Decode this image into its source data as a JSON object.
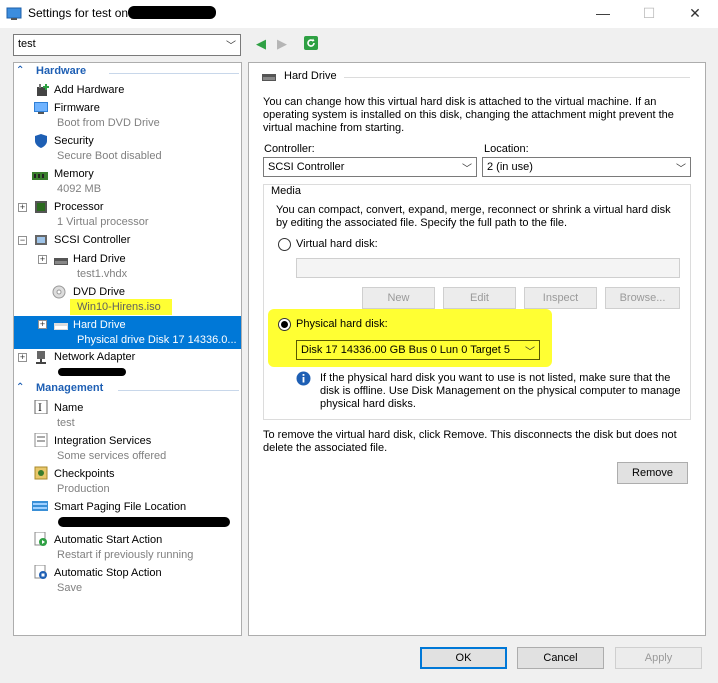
{
  "window": {
    "title": "Settings for test on",
    "minimize_glyph": "—",
    "maximize_glyph": "☐",
    "close_glyph": "✕"
  },
  "vm_selector": {
    "value": "test"
  },
  "tree": {
    "hardware_header": "Hardware",
    "management_header": "Management",
    "items": {
      "add_hardware": {
        "label": "Add Hardware"
      },
      "firmware": {
        "label": "Firmware",
        "sub": "Boot from DVD Drive"
      },
      "security": {
        "label": "Security",
        "sub": "Secure Boot disabled"
      },
      "memory": {
        "label": "Memory",
        "sub": "4092 MB"
      },
      "processor": {
        "label": "Processor",
        "sub": "1 Virtual processor"
      },
      "scsi": {
        "label": "SCSI Controller"
      },
      "hard_drive_1": {
        "label": "Hard Drive",
        "sub": "test1.vhdx"
      },
      "dvd": {
        "label": "DVD Drive",
        "sub": "Win10-Hirens.iso"
      },
      "hard_drive_2": {
        "label": "Hard Drive",
        "sub": "Physical drive Disk 17 14336.0..."
      },
      "network": {
        "label": "Network Adapter"
      },
      "name": {
        "label": "Name",
        "sub": "test"
      },
      "integration": {
        "label": "Integration Services",
        "sub": "Some services offered"
      },
      "checkpoints": {
        "label": "Checkpoints",
        "sub": "Production"
      },
      "paging": {
        "label": "Smart Paging File Location"
      },
      "auto_start": {
        "label": "Automatic Start Action",
        "sub": "Restart if previously running"
      },
      "auto_stop": {
        "label": "Automatic Stop Action",
        "sub": "Save"
      }
    }
  },
  "pane": {
    "heading": "Hard Drive",
    "intro_lines": [
      "You can change how this virtual hard disk is attached to the virtual machine. If an",
      "operating system is installed on this disk, changing the attachment might prevent the",
      "virtual machine from starting."
    ],
    "controller_label": "Controller:",
    "controller_value": "SCSI Controller",
    "location_label": "Location:",
    "location_value": "2 (in use)",
    "media_label": "Media",
    "media_lines": [
      "You can compact, convert, expand, merge, reconnect or shrink a virtual hard disk",
      "by editing the associated file. Specify the full path to the file."
    ],
    "virtual_hd_label": "Virtual hard disk:",
    "buttons": {
      "new": "New",
      "edit": "Edit",
      "inspect": "Inspect",
      "browse": "Browse..."
    },
    "physical_hd_label": "Physical hard disk:",
    "physical_hd_value": "Disk 17 14336.00 GB Bus 0 Lun 0 Target 5",
    "info_lines": [
      "If the physical hard disk you want to use is not listed, make sure that the",
      "disk is offline. Use Disk Management on the physical computer to manage",
      "physical hard disks."
    ],
    "remove_lines": [
      "To remove the virtual hard disk, click Remove. This disconnects the disk but does not",
      "delete the associated file."
    ],
    "remove_button": "Remove"
  },
  "footer": {
    "ok": "OK",
    "cancel": "Cancel",
    "apply": "Apply"
  },
  "colors": {
    "accent": "#0078d7",
    "section": "#1e5fb4",
    "highlight": "#ffff33"
  }
}
